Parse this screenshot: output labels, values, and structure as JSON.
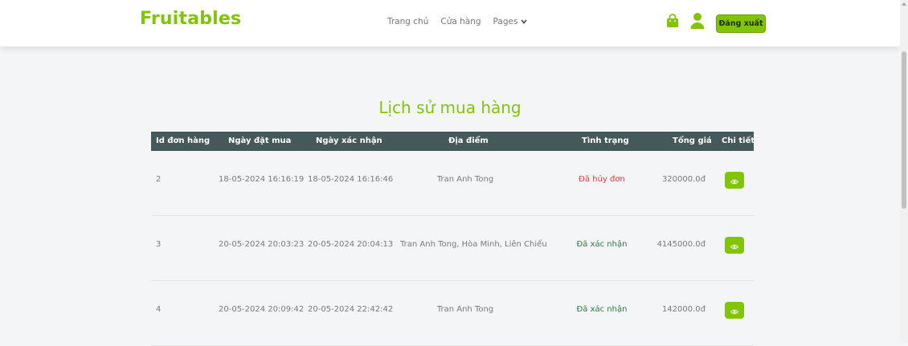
{
  "header": {
    "brand": "Fruitables",
    "nav": [
      {
        "label": "Trang chủ"
      },
      {
        "label": "Cửa hàng"
      },
      {
        "label": "Pages"
      }
    ],
    "logout_label": "Đăng xuất",
    "accent": "#81c408"
  },
  "main": {
    "title": "Lịch sử mua hàng",
    "columns": [
      "Id đơn hàng",
      "Ngày đặt mua",
      "Ngày xác nhận",
      "Địa điểm",
      "Tình trạng",
      "Tổng giá",
      "Chi tiết"
    ],
    "rows": [
      {
        "id": "2",
        "order_date": "18-05-2024 16:16:19",
        "confirm_date": "18-05-2024 16:16:46",
        "place": "Tran Anh Tong",
        "status": "Đã hủy đơn",
        "status_color": "#e03b3b",
        "total": "320000.0đ"
      },
      {
        "id": "3",
        "order_date": "20-05-2024 20:03:23",
        "confirm_date": "20-05-2024 20:04:13",
        "place": "Tran Anh Tong, Hòa Minh, Liên Chiểu",
        "status": "Đã xác nhận",
        "status_color": "#2f7a45",
        "total": "4145000.0đ"
      },
      {
        "id": "4",
        "order_date": "20-05-2024 20:09:42",
        "confirm_date": "20-05-2024 22:42:42",
        "place": "Tran Anh Tong",
        "status": "Đã xác nhận",
        "status_color": "#2f7a45",
        "total": "142000.0đ"
      }
    ]
  },
  "icons": {
    "cart": "shopping-bag-icon",
    "user": "user-icon",
    "detail": "eye-icon",
    "pages_caret": "chevron-down-icon"
  }
}
